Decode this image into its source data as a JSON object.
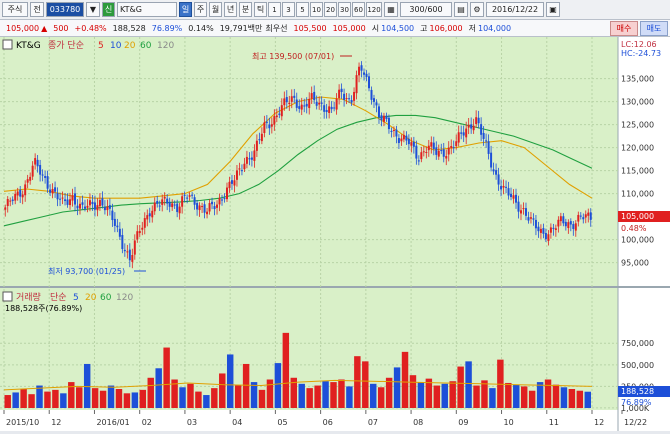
{
  "toolbar": {
    "market": "주식",
    "mode": "전",
    "code": "033780",
    "kospi_badge": "신",
    "stock_name": "KT&G",
    "view_buttons": [
      "일",
      "주",
      "월",
      "년",
      "분",
      "틱"
    ],
    "intervals": [
      "1",
      "3",
      "5",
      "10",
      "20",
      "30",
      "60",
      "120"
    ],
    "period": "300/600",
    "date": "2016/12/22"
  },
  "quote": {
    "price": "105,000",
    "change": "500",
    "change_pct": "+0.48%",
    "volume": "188,528",
    "volume_ratio": "76.89%",
    "turnover": "0.14%",
    "amount": "19,791백만",
    "best_ask_label": "최우선",
    "best_ask": "105,500",
    "best_bid": "105,000",
    "open_label": "시",
    "open": "104,500",
    "high_label": "고",
    "high": "106,000",
    "low_label": "저",
    "low": "104,000",
    "buy_label": "매수",
    "sell_label": "매도"
  },
  "legend_price": {
    "name": "KT&G",
    "ma_label": "종가 단순",
    "ma": [
      "5",
      "10",
      "20",
      "60",
      "120"
    ]
  },
  "legend_volume": {
    "name": "거래량",
    "ma_label": "단순",
    "ma": [
      "5",
      "20",
      "60",
      "120"
    ],
    "value": "188,528주(76.89%)"
  },
  "lc_label": "LC:12.06",
  "hc_label": "HC:-24.73",
  "high_annotation": "최고 139,500 (07/01)",
  "low_annotation": "최저 93,700 (01/25)",
  "current_price_tag": "105,000",
  "current_pct_tag": "0.48%",
  "volume_tag": "188,528",
  "volume_pct_tag": "76.89%",
  "price_axis": [
    "135,000",
    "130,000",
    "125,000",
    "120,000",
    "115,000",
    "110,000",
    "100,000",
    "95,000"
  ],
  "volume_axis": [
    "1,000K",
    "750,000",
    "500,000",
    "250,000"
  ],
  "date_axis": [
    "2015/10",
    "12",
    "2016/01",
    "02",
    "03",
    "04",
    "05",
    "06",
    "07",
    "08",
    "09",
    "10",
    "11",
    "12",
    "12/22"
  ],
  "chart_data": {
    "type": "line",
    "title": "KT&G",
    "price_range": [
      91000,
      141000
    ],
    "close_path": [
      107000,
      109000,
      111500,
      116500,
      113500,
      110500,
      107500,
      109500,
      106500,
      107500,
      108500,
      105000,
      100500,
      95500,
      102000,
      106500,
      107500,
      108500,
      107000,
      109500,
      108000,
      106000,
      107500,
      111000,
      113000,
      117500,
      119000,
      124500,
      126500,
      129000,
      131000,
      128500,
      130500,
      129500,
      127500,
      132500,
      130000,
      137500,
      133000,
      126500,
      124500,
      122500,
      121000,
      118000,
      120500,
      118500,
      119500,
      121000,
      124000,
      126500,
      120500,
      114500,
      110500,
      108500,
      106500,
      103000,
      101500,
      102000,
      104000,
      103500,
      104500,
      105000
    ],
    "ma_slow": [
      103000,
      104000,
      105000,
      106000,
      106500,
      107000,
      107500,
      107800,
      108000,
      108200,
      108500,
      109000,
      110000,
      112000,
      115000,
      118500,
      121500,
      124000,
      125500,
      126500,
      127000,
      127000,
      126500,
      125500,
      124500,
      123500,
      122500,
      121000,
      119500,
      117500,
      115500
    ],
    "ma_mid": [
      110500,
      111000,
      110500,
      109500,
      109000,
      109000,
      109000,
      109500,
      110000,
      112000,
      117000,
      123000,
      127500,
      130000,
      131000,
      130500,
      128000,
      125000,
      121500,
      119500,
      120000,
      121000,
      121500,
      120000,
      116000,
      112000,
      109000
    ],
    "volume_range": [
      0,
      1100000
    ],
    "volume_bars": [
      150000,
      180000,
      220000,
      160000,
      260000,
      190000,
      210000,
      170000,
      300000,
      240000,
      510000,
      230000,
      200000,
      260000,
      220000,
      170000,
      180000,
      210000,
      350000,
      460000,
      700000,
      330000,
      240000,
      280000,
      190000,
      150000,
      230000,
      400000,
      620000,
      260000,
      510000,
      300000,
      210000,
      330000,
      520000,
      870000,
      350000,
      280000,
      230000,
      260000,
      310000,
      300000,
      330000,
      250000,
      600000,
      540000,
      280000,
      240000,
      350000,
      470000,
      650000,
      380000,
      300000,
      340000,
      260000,
      280000,
      310000,
      480000,
      540000,
      260000,
      320000,
      230000,
      560000,
      290000,
      270000,
      250000,
      200000,
      300000,
      330000,
      270000,
      240000,
      220000,
      200000,
      188528
    ],
    "volume_ma": [
      210000,
      230000,
      250000,
      240000,
      260000,
      290000,
      270000,
      260000,
      300000,
      320000,
      310000,
      300000,
      290000,
      280000,
      270000,
      260000,
      250000
    ]
  }
}
